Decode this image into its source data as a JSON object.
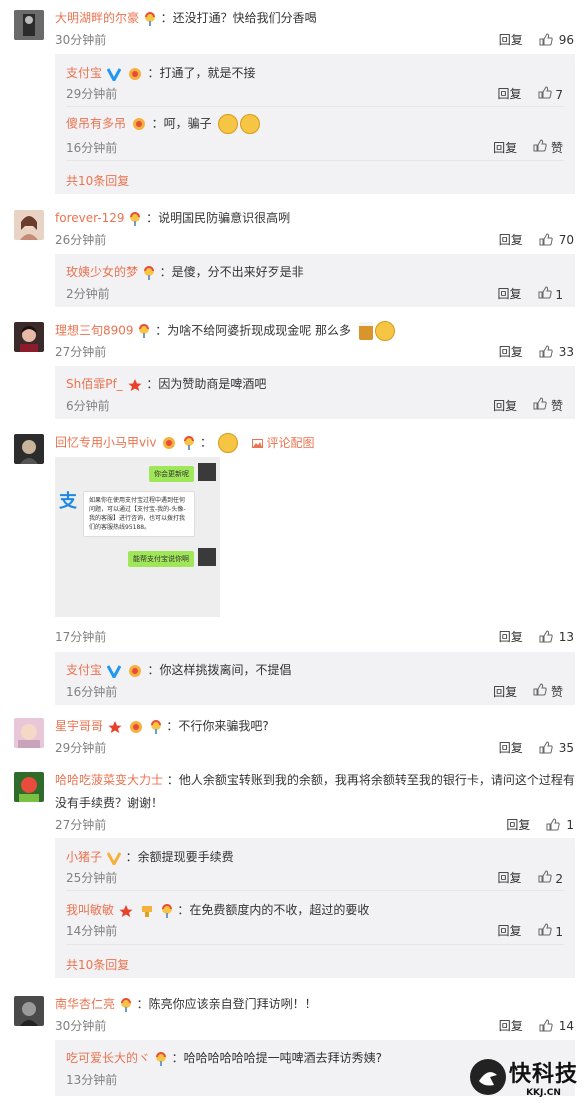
{
  "comments": [
    {
      "user": "大明湖畔的尔豪",
      "text": "：还没打通？快给我们分香喝",
      "time": "30分钟前",
      "reply": "回复",
      "likes": "96",
      "subs": [
        {
          "user": "支付宝",
          "text": "：打通了，就是不接",
          "time": "29分钟前",
          "reply": "回复",
          "likes": "7"
        },
        {
          "user": "傻吊有多吊",
          "text": "：呵，骗子",
          "time": "16分钟前",
          "reply": "回复",
          "likes": "赞"
        }
      ],
      "more": "共10条回复"
    },
    {
      "user": "forever-129",
      "text": "：说明国民防骗意识很高咧",
      "time": "26分钟前",
      "reply": "回复",
      "likes": "70",
      "subs": [
        {
          "user": "玫姨少女的梦",
          "text": "：是傻，分不出来好歹是非",
          "time": "2分钟前",
          "reply": "回复",
          "likes": "1"
        }
      ]
    },
    {
      "user": "理想三旬8909",
      "text": "：为啥不给阿婆折现成现金呢  那么多",
      "time": "27分钟前",
      "reply": "回复",
      "likes": "33",
      "subs": [
        {
          "user": "Sh佰霏Pf_",
          "text": "：因为赞助商是啤酒吧",
          "time": "6分钟前",
          "reply": "回复",
          "likes": "赞"
        }
      ]
    },
    {
      "user": "回忆专用小马甲viv",
      "link": "评论配图",
      "time": "17分钟前",
      "reply": "回复",
      "likes": "13",
      "shot": {
        "bubble1": "你会更新呢",
        "info": "如果你在使用支付宝过程中遇到任何问题，可以通过【支付宝-我的-头像-我的客服】进行咨询，也可以拨打我们的客服热线95188。",
        "bubble2": "能帮支付宝说你啊"
      },
      "subs": [
        {
          "user": "支付宝",
          "text": "：你这样挑拨离间，不提倡",
          "time": "16分钟前",
          "reply": "回复",
          "likes": "赞"
        }
      ]
    },
    {
      "user": "星宇哥哥",
      "text": "：不行你来骗我吧?",
      "time": "29分钟前",
      "reply": "回复",
      "likes": "35"
    },
    {
      "user": "哈哈吃菠菜变大力士",
      "text": "：他人余额宝转账到我的余额，我再将余额转至我的银行卡，请问这个过程有",
      "text2": "没有手续费？谢谢！",
      "time": "27分钟前",
      "reply": "回复",
      "likes": "1",
      "subs": [
        {
          "user": "小猪子",
          "text": "：余额提现要手续费",
          "time": "25分钟前",
          "reply": "回复",
          "likes": "2"
        },
        {
          "user": "我叫敏敏",
          "text": "：在免费额度内的不收，超过的要收",
          "time": "14分钟前",
          "reply": "回复",
          "likes": "1"
        }
      ],
      "more": "共10条回复"
    },
    {
      "user": "南华杏仁亮",
      "text": "：陈亮你应该亲自登门拜访咧！！",
      "time": "30分钟前",
      "reply": "回复",
      "likes": "14",
      "subs": [
        {
          "user": "吃可爱长大的ヾ",
          "text": "：哈哈哈哈哈哈提一吨啤酒去拜访秀姨?",
          "time": "13分钟前",
          "reply": "回复",
          "likes": ""
        }
      ]
    }
  ],
  "watermark": {
    "cn": "快科技",
    "en": "KKJ.CN"
  },
  "colors": {
    "username": "#eb7350",
    "meta": "#808080",
    "sub_bg": "#f2f2f5"
  }
}
